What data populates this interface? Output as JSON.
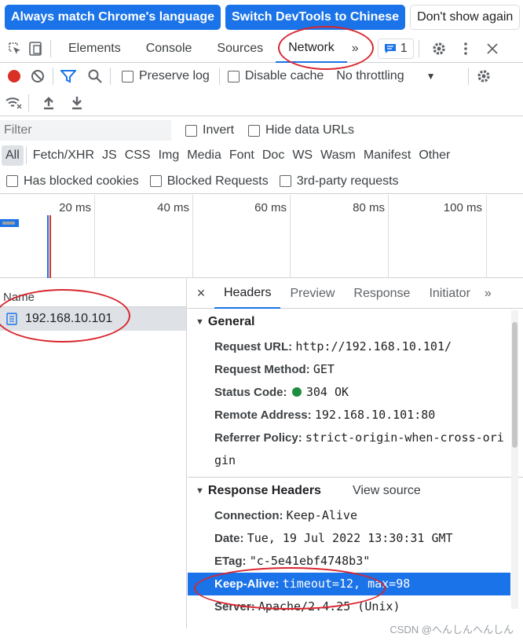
{
  "infobar": {
    "match_language": "Always match Chrome's language",
    "switch_chinese": "Switch DevTools to Chinese",
    "dont_show": "Don't show again"
  },
  "tabs": {
    "elements": "Elements",
    "console": "Console",
    "sources": "Sources",
    "network": "Network",
    "more": "»",
    "issues_count": "1"
  },
  "toolbar": {
    "preserve_log": "Preserve log",
    "disable_cache": "Disable cache",
    "throttling": "No throttling"
  },
  "filter": {
    "placeholder": "Filter",
    "invert": "Invert",
    "hide_data_urls": "Hide data URLs"
  },
  "types": [
    "All",
    "Fetch/XHR",
    "JS",
    "CSS",
    "Img",
    "Media",
    "Font",
    "Doc",
    "WS",
    "Wasm",
    "Manifest",
    "Other"
  ],
  "blocked": {
    "has_blocked_cookies": "Has blocked cookies",
    "blocked_requests": "Blocked Requests",
    "third_party": "3rd-party requests"
  },
  "overview": {
    "ticks": [
      "20 ms",
      "40 ms",
      "60 ms",
      "80 ms",
      "100 ms"
    ]
  },
  "requests": {
    "column_name": "Name",
    "items": [
      "192.168.10.101"
    ]
  },
  "details": {
    "tabs": [
      "Headers",
      "Preview",
      "Response",
      "Initiator"
    ],
    "more": "»",
    "general_title": "General",
    "general": {
      "request_url_k": "Request URL:",
      "request_url_v": "http://192.168.10.101/",
      "method_k": "Request Method:",
      "method_v": "GET",
      "status_k": "Status Code:",
      "status_v": "304 OK",
      "remote_k": "Remote Address:",
      "remote_v": "192.168.10.101:80",
      "referrer_k": "Referrer Policy:",
      "referrer_v1": "strict-origin-when-cross-ori",
      "referrer_v2": "gin"
    },
    "response_title": "Response Headers",
    "view_source": "View source",
    "response": {
      "connection_k": "Connection:",
      "connection_v": "Keep-Alive",
      "date_k": "Date:",
      "date_v": "Tue, 19 Jul 2022 13:30:31 GMT",
      "etag_k": "ETag:",
      "etag_v": "\"c-5e41ebf4748b3\"",
      "keepalive_k": "Keep-Alive:",
      "keepalive_v": "timeout=12, max=98",
      "server_k": "Server:",
      "server_v": "Apache/2.4.25 (Unix)"
    }
  },
  "watermark": "CSDN @へんしんへんしん",
  "colors": {
    "accent": "#1a73e8",
    "record": "#d93025",
    "status_ok": "#1e8e3e",
    "annotation": "#d9262f"
  }
}
